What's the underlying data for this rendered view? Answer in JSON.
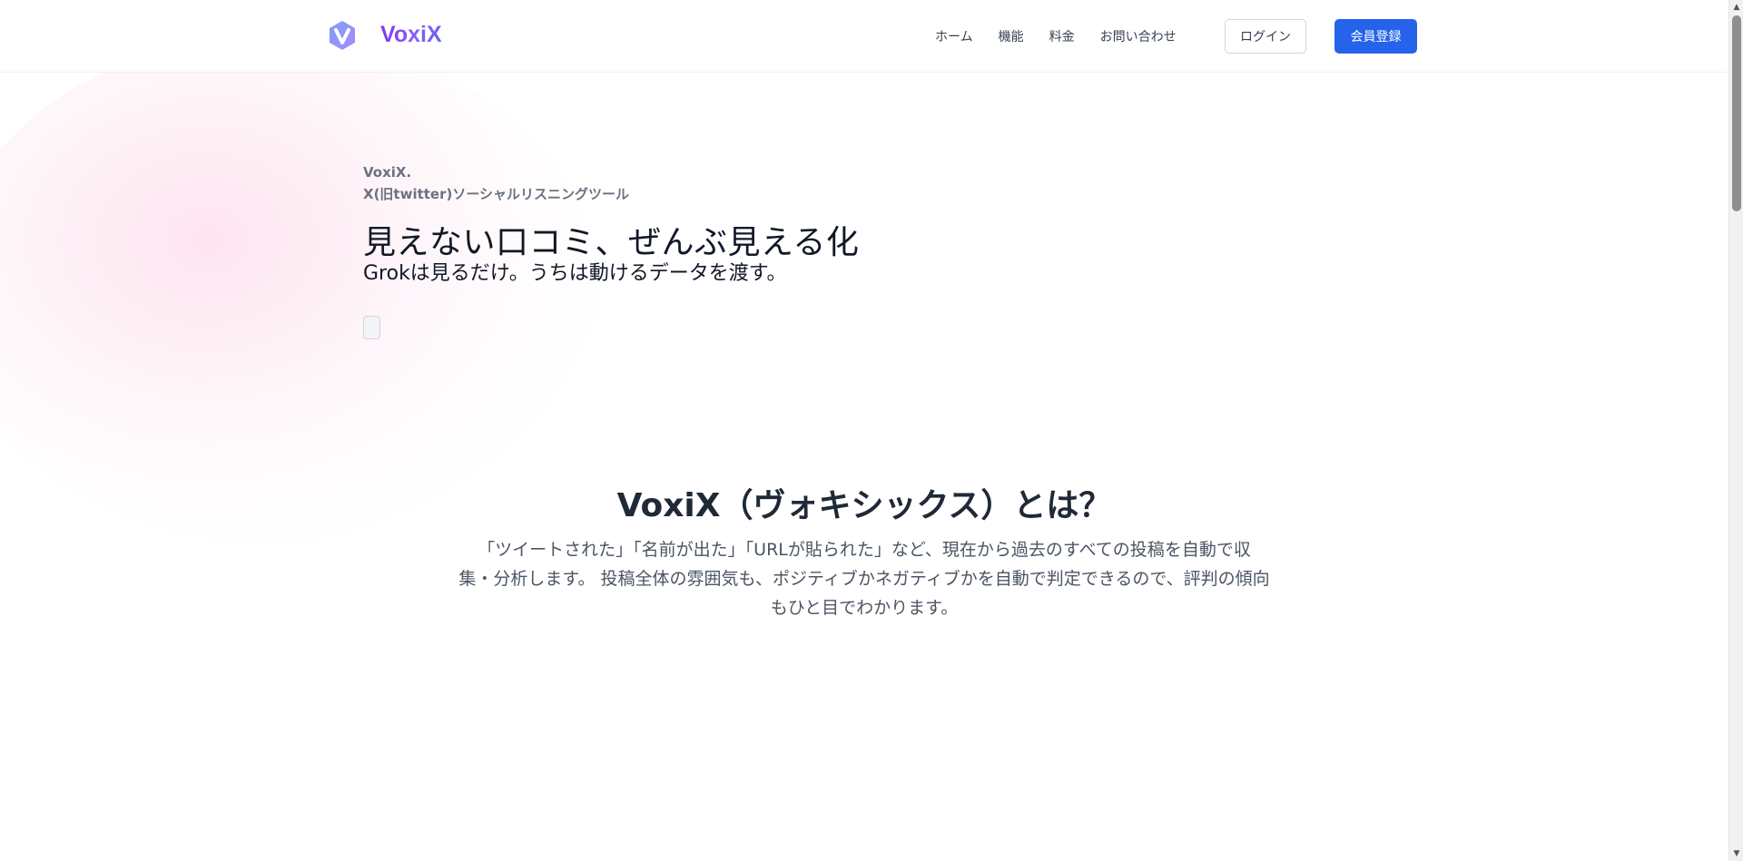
{
  "header": {
    "brand": "VoxiX",
    "nav": [
      "ホーム",
      "機能",
      "料金",
      "お問い合わせ"
    ],
    "login_label": "ログイン",
    "signup_label": "会員登録"
  },
  "hero": {
    "kicker_line1": "VoxiX.",
    "kicker_line2": "X(旧twitter)ソーシャルリスニングツール",
    "title": "見えない口コミ、ぜんぶ見える化",
    "subtitle": "Grokは見るだけ。うちは動けるデータを渡す。"
  },
  "about": {
    "title": "VoxiX（ヴォキシックス）とは？",
    "lines": [
      "「ツイートされた」「名前が出た」「URLが貼られた」など、現在から過去のすべての投稿を自動で収",
      "集・分析します。 投稿全体の雰囲気も、ポジティブかネガティブかを自動で判定できるので、評判の傾向もひと目でわかります。"
    ]
  },
  "colors": {
    "brand_gradient_start": "#7c3aed",
    "brand_gradient_end": "#6366f1",
    "primary_button": "#2563eb",
    "logo_gradient_start": "#6c8cf5",
    "logo_gradient_end": "#b48cf2"
  },
  "icons": {
    "logo": "v-logo-icon",
    "scroll_up": "scroll-up-arrow-icon",
    "scroll_down": "scroll-down-arrow-icon"
  }
}
